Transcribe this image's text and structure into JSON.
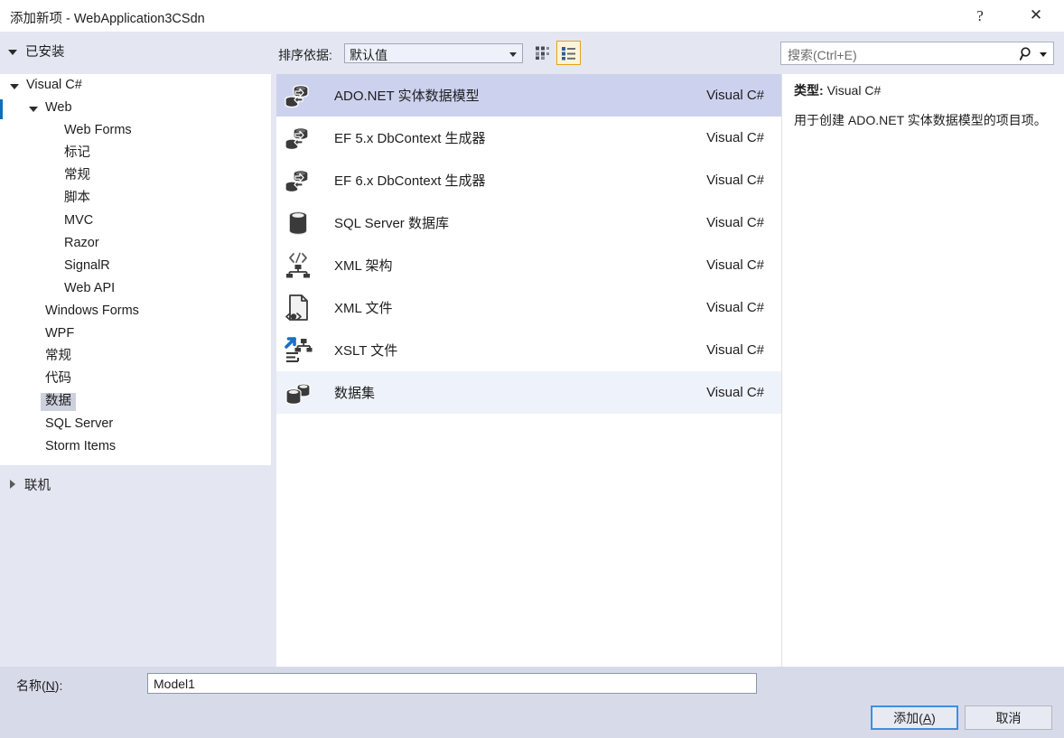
{
  "window": {
    "title": "添加新项 - WebApplication3CSdn",
    "help_glyph": "?",
    "close_glyph": "✕"
  },
  "header": {
    "installed_label": "已安装",
    "sort_label": "排序依据:",
    "sort_value": "默认值",
    "view_tiles_name": "medium-icons-view",
    "view_list_name": "list-view"
  },
  "search": {
    "placeholder": "搜索(Ctrl+E)"
  },
  "tree": {
    "items": [
      {
        "label": "Visual C#",
        "indent": 0,
        "arrow": "down",
        "selected": false
      },
      {
        "label": "Web",
        "indent": 1,
        "arrow": "down",
        "selected": false
      },
      {
        "label": "Web Forms",
        "indent": 2,
        "arrow": "none",
        "selected": false
      },
      {
        "label": "标记",
        "indent": 2,
        "arrow": "none",
        "selected": false
      },
      {
        "label": "常规",
        "indent": 2,
        "arrow": "none",
        "selected": false
      },
      {
        "label": "脚本",
        "indent": 2,
        "arrow": "none",
        "selected": false
      },
      {
        "label": "MVC",
        "indent": 2,
        "arrow": "none",
        "selected": false
      },
      {
        "label": "Razor",
        "indent": 2,
        "arrow": "none",
        "selected": false
      },
      {
        "label": "SignalR",
        "indent": 2,
        "arrow": "none",
        "selected": false
      },
      {
        "label": "Web API",
        "indent": 2,
        "arrow": "none",
        "selected": false
      },
      {
        "label": "Windows Forms",
        "indent": 1,
        "arrow": "none",
        "selected": false
      },
      {
        "label": "WPF",
        "indent": 1,
        "arrow": "none",
        "selected": false
      },
      {
        "label": "常规",
        "indent": 1,
        "arrow": "none",
        "selected": false
      },
      {
        "label": "代码",
        "indent": 1,
        "arrow": "none",
        "selected": false
      },
      {
        "label": "数据",
        "indent": 1,
        "arrow": "none",
        "selected": true
      },
      {
        "label": "SQL Server",
        "indent": 1,
        "arrow": "none",
        "selected": false
      },
      {
        "label": "Storm Items",
        "indent": 1,
        "arrow": "none",
        "selected": false
      }
    ],
    "online_label": "联机"
  },
  "list": {
    "rows": [
      {
        "title": "ADO.NET 实体数据模型",
        "lang": "Visual C#",
        "icon": "entity-model-icon",
        "state": "selected"
      },
      {
        "title": "EF 5.x DbContext 生成器",
        "lang": "Visual C#",
        "icon": "entity-model-icon",
        "state": "normal"
      },
      {
        "title": "EF 6.x DbContext 生成器",
        "lang": "Visual C#",
        "icon": "entity-model-icon",
        "state": "normal"
      },
      {
        "title": "SQL Server 数据库",
        "lang": "Visual C#",
        "icon": "database-icon",
        "state": "normal"
      },
      {
        "title": "XML 架构",
        "lang": "Visual C#",
        "icon": "xml-schema-icon",
        "state": "normal"
      },
      {
        "title": "XML 文件",
        "lang": "Visual C#",
        "icon": "xml-file-icon",
        "state": "normal"
      },
      {
        "title": "XSLT 文件",
        "lang": "Visual C#",
        "icon": "xslt-file-icon",
        "state": "normal"
      },
      {
        "title": "数据集",
        "lang": "Visual C#",
        "icon": "dataset-icon",
        "state": "hovered"
      }
    ]
  },
  "detail": {
    "type_key": "类型:",
    "type_value": "Visual C#",
    "description": "用于创建 ADO.NET 实体数据模型的项目项。"
  },
  "footer": {
    "name_label_prefix": "名称(",
    "name_label_key": "N",
    "name_label_suffix": "):",
    "name_value": "Model1",
    "add_prefix": "添加(",
    "add_key": "A",
    "add_suffix": ")",
    "cancel_label": "取消"
  },
  "colors": {
    "header_bg": "#e4e7f2",
    "selected_row": "#ccd2ee",
    "hovered_row": "#eef2fb",
    "tree_selected": "#cdd0dd",
    "accent_blue": "#0d6ebb",
    "view_active_border": "#e3a315",
    "default_button_border": "#3f8fdd"
  }
}
